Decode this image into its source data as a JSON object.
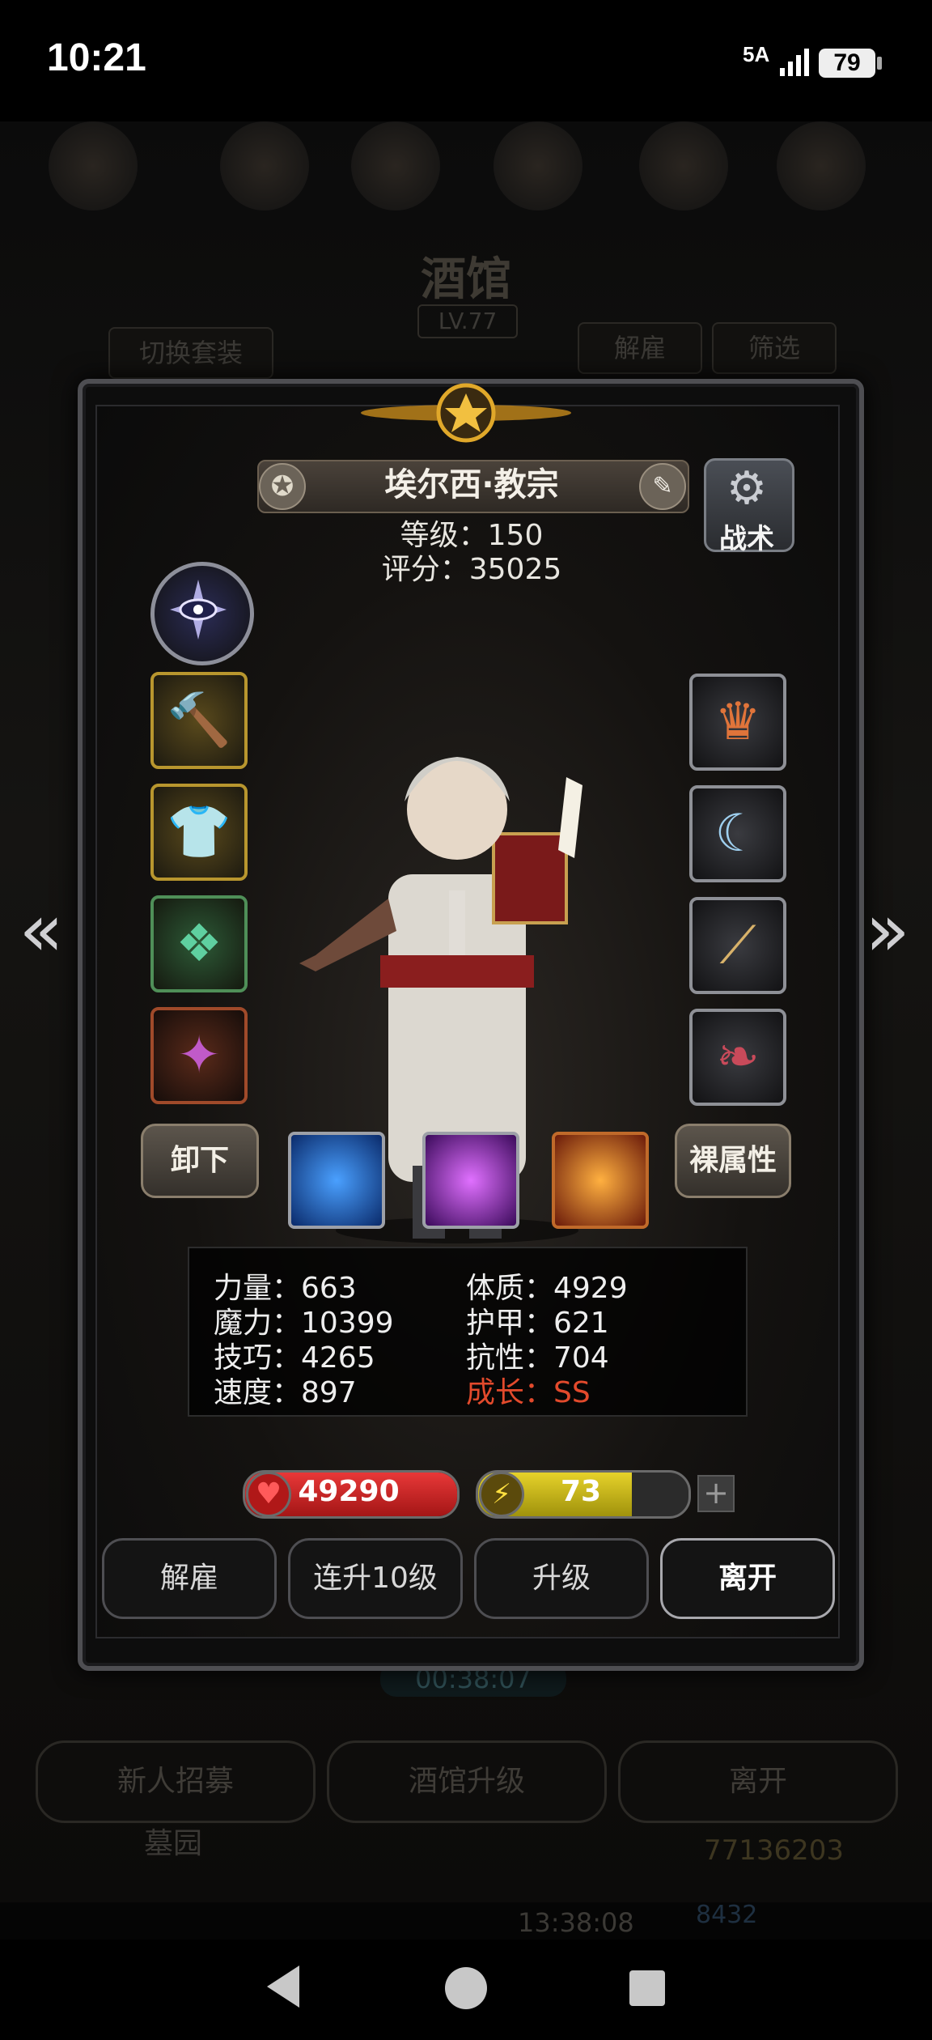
{
  "status_bar": {
    "time": "10:21",
    "network": "5A",
    "battery": "79"
  },
  "background": {
    "title": "酒馆",
    "level": "LV.77",
    "switch_outfit": "切换套装",
    "dismiss": "解雇",
    "filter": "筛选",
    "timer": "00:38:07",
    "new_recruit": "新人招募",
    "tavern_upgrade": "酒馆升级",
    "leave": "离开",
    "cemetery": "墓园",
    "gold": "77136203",
    "gems": "8432",
    "bottom_timer": "13:38:08"
  },
  "hero": {
    "name": "埃尔西·教宗",
    "level_line": "等级：150",
    "score_line": "评分：35025",
    "tactics_label": "战术"
  },
  "actions": {
    "unequip": "卸下",
    "base_attributes": "裸属性"
  },
  "stats": {
    "strength": "力量：663",
    "magic": "魔力：10399",
    "skill": "技巧：4265",
    "speed": "速度：897",
    "constitution": "体质：4929",
    "armor": "护甲：621",
    "resistance": "抗性：704",
    "growth": "成长：SS"
  },
  "bars": {
    "hp_value": "49290",
    "hp_fraction": 1.0,
    "energy_value": "73",
    "energy_fraction": 0.73
  },
  "buttons": {
    "dismiss": "解雇",
    "level_up_10": "连升10级",
    "level_up": "升级",
    "leave": "离开"
  },
  "colors": {
    "growth": "#e24a2c",
    "hp": "#e83838",
    "energy": "#e6d22a"
  }
}
